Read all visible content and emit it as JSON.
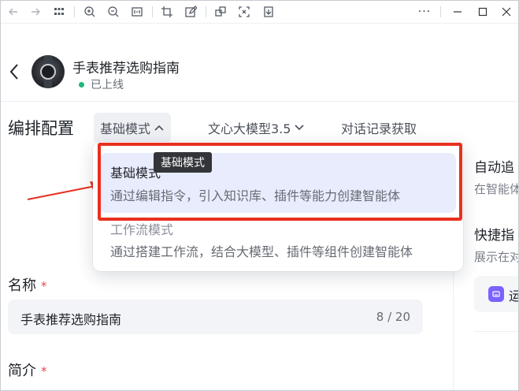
{
  "toolbar": {
    "icons": [
      "back-arrow-icon",
      "forward-arrow-icon",
      "grid-icon",
      "zoom-in-icon",
      "zoom-out-icon",
      "fit-icon",
      "crop-icon",
      "edit-icon",
      "copy-icon",
      "scan-icon",
      "download-icon",
      "more-icon",
      "minimize-icon",
      "maximize-icon",
      "close-icon"
    ],
    "more_label": "···"
  },
  "header": {
    "title": "手表推荐选购指南",
    "status": "已上线",
    "status_color": "#1fb87a"
  },
  "tabs_row": {
    "section_title": "编排配置",
    "tabs": [
      {
        "label": "基础模式"
      },
      {
        "label": "文心大模型3.5"
      },
      {
        "label": "对话记录获取"
      }
    ]
  },
  "dropdown": {
    "options": [
      {
        "title": "基础模式",
        "desc": "通过编辑指令，引入知识库、插件等能力创建智能体"
      },
      {
        "title": "工作流模式",
        "desc": "通过搭建工作流，结合大模型、插件等组件创建智能体"
      }
    ],
    "tooltip": "基础模式"
  },
  "right_panel": {
    "heading1": "自动追",
    "sub1": "在智能体",
    "heading2": "快捷指",
    "sub2": "展示在对",
    "card_text": "运"
  },
  "form": {
    "name_label": "名称",
    "name_value": "手表推荐选购指南",
    "name_count": "8 / 20",
    "intro_label": "简介",
    "required_mark": "*"
  },
  "colors": {
    "accent_highlight": "#e8301f",
    "selected_bg": "#e9ecfd"
  }
}
